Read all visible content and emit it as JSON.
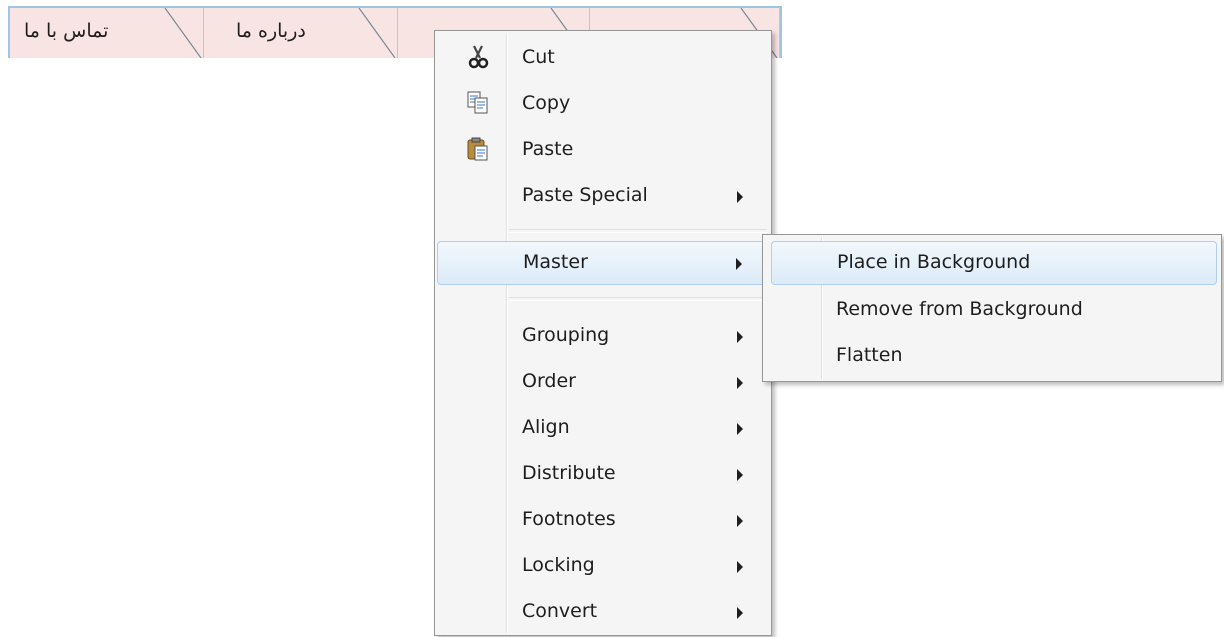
{
  "tabs": [
    {
      "label": "تماس با ما"
    },
    {
      "label": "درباره ما"
    },
    {
      "label": ""
    },
    {
      "label": ""
    }
  ],
  "context_menu": {
    "items": [
      {
        "label": "Cut",
        "icon": "scissors-icon"
      },
      {
        "label": "Copy",
        "icon": "copy-icon"
      },
      {
        "label": "Paste",
        "icon": "paste-icon"
      },
      {
        "label": "Paste Special",
        "submenu": true
      },
      {
        "label": "Master",
        "submenu": true,
        "highlighted": true
      },
      {
        "label": "Grouping",
        "submenu": true
      },
      {
        "label": "Order",
        "submenu": true
      },
      {
        "label": "Align",
        "submenu": true
      },
      {
        "label": "Distribute",
        "submenu": true
      },
      {
        "label": "Footnotes",
        "submenu": true
      },
      {
        "label": "Locking",
        "submenu": true
      },
      {
        "label": "Convert",
        "submenu": true
      }
    ]
  },
  "submenu": {
    "parent": "Master",
    "items": [
      {
        "label": "Place in Background",
        "highlighted": true
      },
      {
        "label": "Remove from Background"
      },
      {
        "label": "Flatten"
      }
    ]
  },
  "colors": {
    "tab_fill": "#f9e4e4",
    "tab_border": "#9ec4e6",
    "menu_bg": "#f5f5f5",
    "highlight": "#dcebf8"
  }
}
